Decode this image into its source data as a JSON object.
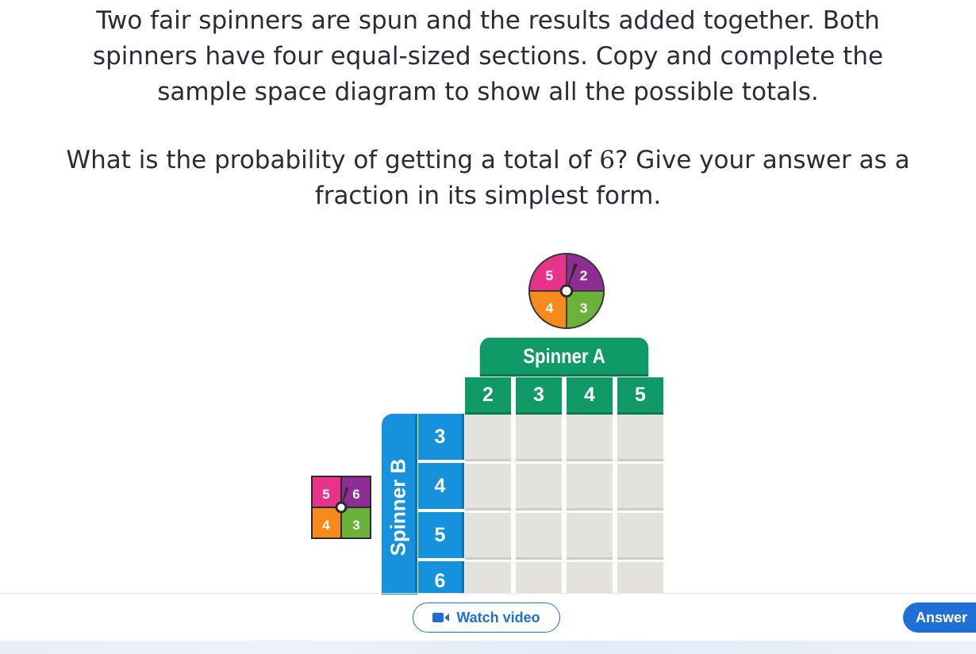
{
  "question": {
    "line1": "Two fair spinners are spun and the results added together. Both",
    "line2": "spinners have four equal-sized sections. Copy and complete the",
    "line3": "sample space diagram to show all the possible totals.",
    "prompt_before": "What is the probability of getting a total of ",
    "prompt_math": "6",
    "prompt_after": "? Give your answer as a",
    "prompt_line2": "fraction in its simplest form."
  },
  "spinner_a": {
    "sections": [
      {
        "label": "5",
        "color": "#e8338a"
      },
      {
        "label": "2",
        "color": "#8e2d93"
      },
      {
        "label": "3",
        "color": "#6ab23a"
      },
      {
        "label": "4",
        "color": "#f78a1d"
      }
    ]
  },
  "spinner_b": {
    "sections": [
      {
        "label": "5",
        "color": "#e8338a"
      },
      {
        "label": "6",
        "color": "#8e2d93"
      },
      {
        "label": "3",
        "color": "#6ab23a"
      },
      {
        "label": "4",
        "color": "#f78a1d"
      }
    ]
  },
  "table": {
    "header_a": "Spinner A",
    "header_b": "Spinner B",
    "a_values": [
      "2",
      "3",
      "4",
      "5"
    ],
    "b_values": [
      "3",
      "4",
      "5",
      "6"
    ],
    "colors": {
      "a": "#0f9a67",
      "b": "#1592db",
      "cell": "#e4e2dc"
    }
  },
  "footer": {
    "watch_video": "Watch video",
    "answer": "Answer",
    "accent": "#1f6fd6"
  }
}
